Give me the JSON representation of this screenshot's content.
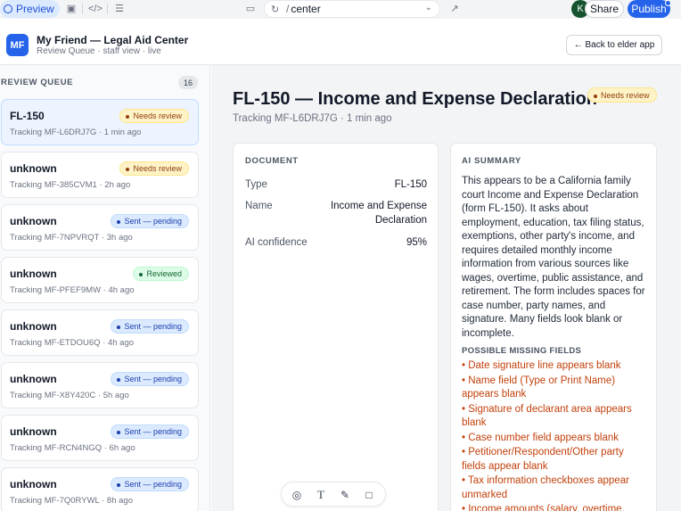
{
  "editor": {
    "preview_label": "Preview",
    "url_path": "center",
    "url_slash": "/",
    "avatar_initial": "K",
    "share_label": "Share",
    "publish_label": "Publish"
  },
  "app": {
    "logo_text": "MF",
    "title": "My Friend — Legal Aid Center",
    "subtitle": "Review Queue · staff view · live",
    "back_label": "← Back to elder app"
  },
  "queue": {
    "heading": "REVIEW QUEUE",
    "count": "16",
    "items": [
      {
        "title": "FL-150",
        "tracking": "Tracking MF-L6DRJ7G · 1 min ago",
        "status": "Needs review"
      },
      {
        "title": "unknown",
        "tracking": "Tracking MF-385CVM1 · 2h ago",
        "status": "Needs review"
      },
      {
        "title": "unknown",
        "tracking": "Tracking MF-7NPVRQT · 3h ago",
        "status": "Sent — pending"
      },
      {
        "title": "unknown",
        "tracking": "Tracking MF-PFEF9MW · 4h ago",
        "status": "Reviewed"
      },
      {
        "title": "unknown",
        "tracking": "Tracking MF-ETDOU6Q · 4h ago",
        "status": "Sent — pending"
      },
      {
        "title": "unknown",
        "tracking": "Tracking MF-X8Y420C · 5h ago",
        "status": "Sent — pending"
      },
      {
        "title": "unknown",
        "tracking": "Tracking MF-RCN4NGQ · 6h ago",
        "status": "Sent — pending"
      },
      {
        "title": "unknown",
        "tracking": "Tracking MF-7Q0RYWL · 8h ago",
        "status": "Sent — pending"
      }
    ]
  },
  "document": {
    "title": "FL-150 — Income and Expense Declaration",
    "status": "Needs review",
    "subtitle": "Tracking MF-L6DRJ7G · 1 min ago",
    "panel_heading": "DOCUMENT",
    "type_label": "Type",
    "type_value": "FL-150",
    "name_label": "Name",
    "name_value_line1": "Income and Expense",
    "name_value_line2": "Declaration",
    "confidence_label": "AI confidence",
    "confidence_value": "95%"
  },
  "ai_summary": {
    "heading": "AI SUMMARY",
    "text": "This appears to be a California family court Income and Expense Declaration (form FL-150). It asks about employment, education, tax filing status, exemptions, other party's income, and requires detailed monthly income information from various sources like wages, overtime, public assistance, and retirement. The form includes spaces for case number, party names, and signature. Many fields look blank or incomplete.",
    "missing_heading": "POSSIBLE MISSING FIELDS",
    "missing_fields": [
      "• Date signature line appears blank",
      "• Name field (Type or Print Name) appears blank",
      "• Signature of declarant area appears blank",
      "• Case number field appears blank",
      "• Petitioner/Respondent/Other party fields appear blank",
      "• Tax information checkboxes appear unmarked",
      "• Income amounts (salary, overtime,"
    ]
  },
  "colors": {
    "accent": "#2563eb",
    "needs_review": "#92400e",
    "sent_pending": "#1e40af",
    "reviewed": "#166534",
    "missing_text": "#c2410c"
  }
}
